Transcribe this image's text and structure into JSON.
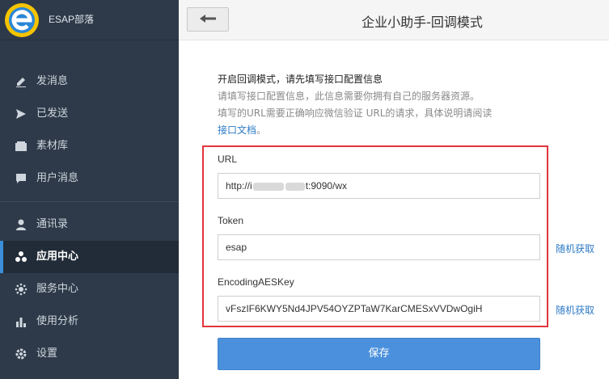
{
  "brand": "ESAP部落",
  "header": {
    "title": "企业小助手-回调模式"
  },
  "sidebar": {
    "items": [
      {
        "label": "发消息",
        "icon": "pencil-icon"
      },
      {
        "label": "已发送",
        "icon": "send-icon"
      },
      {
        "label": "素材库",
        "icon": "folder-icon"
      },
      {
        "label": "用户消息",
        "icon": "chat-icon"
      },
      {
        "label": "通讯录",
        "icon": "user-icon"
      },
      {
        "label": "应用中心",
        "icon": "apps-icon",
        "active": true
      },
      {
        "label": "服务中心",
        "icon": "gear-dots-icon"
      },
      {
        "label": "使用分析",
        "icon": "bar-chart-icon"
      },
      {
        "label": "设置",
        "icon": "settings-icon"
      }
    ]
  },
  "intro": {
    "title": "开启回调模式，请先填写接口配置信息",
    "line1": "请填写接口配置信息，此信息需要你拥有自己的服务器资源。",
    "line2": "填写的URL需要正确响应微信验证 URL的请求，具体说明请阅读",
    "link": "接口文档",
    "link_suffix": "。"
  },
  "form": {
    "url_label": "URL",
    "url_prefix": "http://i",
    "url_suffix": "t:9090/wx",
    "token_label": "Token",
    "token_value": "esap",
    "aes_label": "EncodingAESKey",
    "aes_value": "vFszIF6KWY5Nd4JPV54OYZPTaW7KarCMESxVVDwOgiH",
    "random_label": "随机获取"
  },
  "save_label": "保存",
  "colors": {
    "sidebar_bg": "#2e3a49",
    "accent": "#4a90dc",
    "highlight_border": "#e2353d"
  }
}
